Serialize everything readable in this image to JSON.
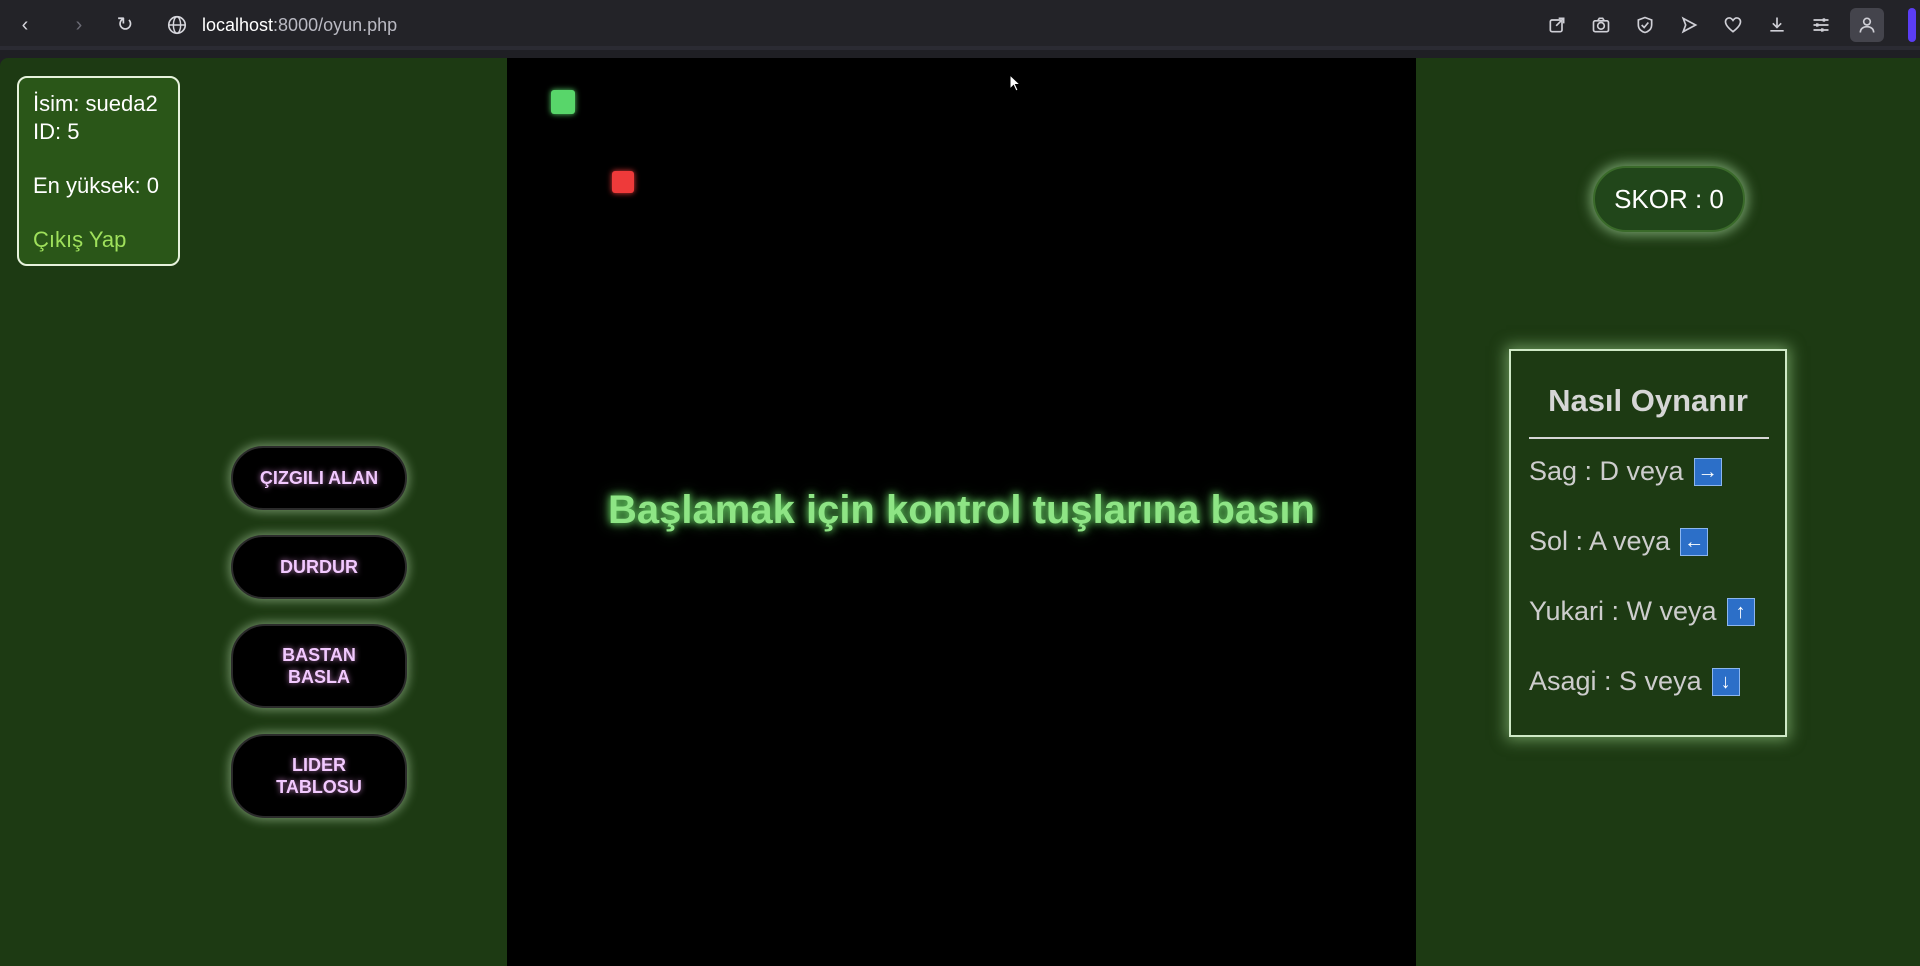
{
  "browser": {
    "url_host": "localhost",
    "url_path": ":8000/oyun.php",
    "nav": {
      "back": "‹",
      "forward": "›",
      "reload": "↻"
    }
  },
  "user": {
    "name_line": "İsim: sueda2",
    "id_line": "ID: 5",
    "highscore_line": "En yüksek: 0",
    "logout": "Çıkış Yap"
  },
  "buttons": {
    "striped": "ÇIZGILI ALAN",
    "pause": "DURDUR",
    "restart_1": "BASTAN",
    "restart_2": "BASLA",
    "leader_1": "LIDER",
    "leader_2": "TABLOSU"
  },
  "game": {
    "start_message": "Başlamak için kontrol tuşlarına basın",
    "colors": {
      "snake": "#58d66a",
      "food": "#ee3a3a",
      "message": "#8ee585"
    }
  },
  "score": {
    "label": "SKOR : 0"
  },
  "howto": {
    "title": "Nasıl Oynanır",
    "right": "Sag : D veya",
    "right_key": "→",
    "left": "Sol : A veya",
    "left_key": "←",
    "up": "Yukari : W veya",
    "up_key": "↑",
    "down": "Asagi : S veya",
    "down_key": "↓"
  }
}
